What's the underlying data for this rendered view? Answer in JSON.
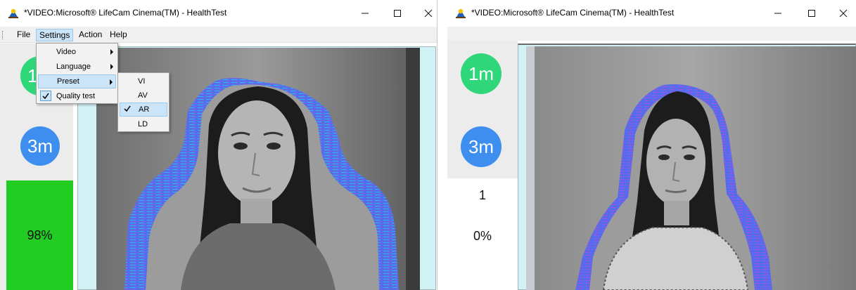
{
  "window_left": {
    "title": "*VIDEO:Microsoft® LifeCam Cinema(TM) - HealthTest",
    "menu": [
      "File",
      "Settings",
      "Action",
      "Help"
    ],
    "settings_menu": {
      "items": [
        {
          "label": "Video",
          "submenu": true
        },
        {
          "label": "Language",
          "submenu": true
        },
        {
          "label": "Preset",
          "submenu": true
        },
        {
          "label": "Quality test",
          "checked": true
        }
      ]
    },
    "preset_menu": {
      "items": [
        {
          "label": "VI",
          "checked": false
        },
        {
          "label": "AV",
          "checked": false
        },
        {
          "label": "AR",
          "checked": true
        },
        {
          "label": "LD",
          "checked": false
        }
      ]
    },
    "panel": {
      "button_1m": "1m",
      "button_3m": "3m",
      "quality_percent": "98%",
      "quality_color": "#22cc22"
    }
  },
  "window_right": {
    "title": "*VIDEO:Microsoft® LifeCam Cinema(TM) - HealthTest",
    "panel": {
      "button_1m": "1m",
      "button_3m": "3m",
      "count": "1",
      "percent": "0%"
    }
  },
  "colors": {
    "btn_1m": "#2fd67a",
    "btn_3m": "#3e8ef0",
    "video_bg": "#d2f2f6",
    "halo_blue": "#4f6ef0",
    "halo_violet": "#a24ee0"
  }
}
